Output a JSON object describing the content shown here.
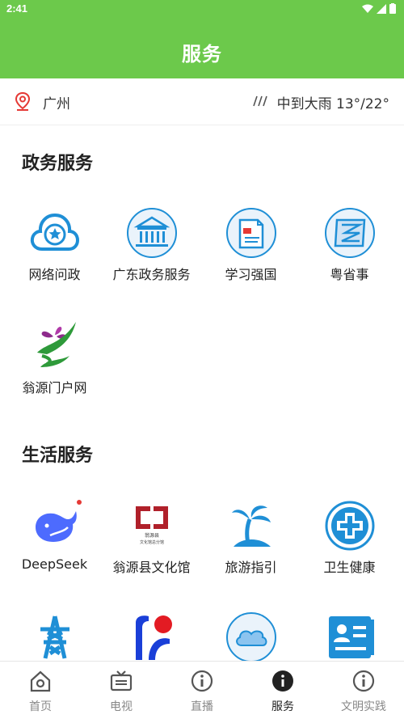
{
  "status": {
    "time": "2:41"
  },
  "header": {
    "title": "服务"
  },
  "location": {
    "city": "广州",
    "weather": "中到大雨 13°/22°"
  },
  "sections": [
    {
      "title": "政务服务",
      "items": [
        {
          "label": "网络问政",
          "icon": "cloud-star-icon"
        },
        {
          "label": "广东政务服务",
          "icon": "government-building-icon"
        },
        {
          "label": "学习强国",
          "icon": "study-book-icon"
        },
        {
          "label": "粤省事",
          "icon": "yue-app-icon"
        },
        {
          "label": "翁源门户网",
          "icon": "orchid-logo-icon"
        }
      ]
    },
    {
      "title": "生活服务",
      "items": [
        {
          "label": "DeepSeek",
          "icon": "whale-icon",
          "badge": true
        },
        {
          "label": "翁源县文化馆",
          "icon": "culture-hall-logo-icon",
          "logo_text": [
            "翁源县",
            "文化馆总分馆"
          ]
        },
        {
          "label": "旅游指引",
          "icon": "palm-island-icon"
        },
        {
          "label": "卫生健康",
          "icon": "medical-cross-icon"
        },
        {
          "label": "",
          "icon": "power-tower-icon"
        },
        {
          "label": "",
          "icon": "red-dot-logo-icon"
        },
        {
          "label": "",
          "icon": "cloud-icon"
        },
        {
          "label": "",
          "icon": "id-card-icon"
        }
      ]
    }
  ],
  "tabs": [
    {
      "label": "首页",
      "icon": "home-icon",
      "active": false
    },
    {
      "label": "电视",
      "icon": "tv-icon",
      "active": false
    },
    {
      "label": "直播",
      "icon": "info-circle-icon",
      "active": false
    },
    {
      "label": "服务",
      "icon": "info-circle-filled-icon",
      "active": true
    },
    {
      "label": "文明实践",
      "icon": "info-circle-icon",
      "active": false
    }
  ],
  "colors": {
    "header_bg": "#6cc94b",
    "icon_blue": "#1f8fd6",
    "badge_red": "#e53935"
  }
}
